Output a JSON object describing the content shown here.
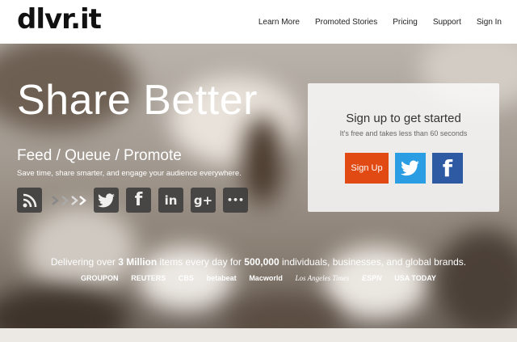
{
  "header": {
    "logo": "dlvr.it",
    "nav": [
      {
        "label": "Learn More"
      },
      {
        "label": "Promoted Stories"
      },
      {
        "label": "Pricing"
      },
      {
        "label": "Support"
      },
      {
        "label": "Sign In"
      }
    ]
  },
  "hero": {
    "headline": "Share Better",
    "sub_headline": "Feed / Queue / Promote",
    "tagline": "Save time, share smarter, and engage your audience everywhere.",
    "icons": [
      "rss-icon",
      "arrows-icon",
      "twitter-icon",
      "facebook-icon",
      "linkedin-icon",
      "google-plus-icon",
      "more-icon"
    ],
    "icon_glyphs": {
      "facebook": "f",
      "linkedin": "in",
      "google_plus": "g+",
      "more": "•••"
    }
  },
  "signup_panel": {
    "title": "Sign up to get started",
    "note": "It's free and takes less than 60 seconds",
    "signup_label": "Sign Up"
  },
  "stats": {
    "prefix": "Delivering over ",
    "items": "3 Million",
    "middle": " items every day for ",
    "individuals": "500,000",
    "suffix": " individuals, businesses, and global brands."
  },
  "brands": [
    "GROUPON",
    "REUTERS",
    "CBS",
    "betabeat",
    "Macworld",
    "Los Angeles Times",
    "ESPN",
    "USA TODAY"
  ],
  "colors": {
    "signup": "#e14b13",
    "twitter": "#2b9ee3",
    "facebook": "#2e5aa4"
  }
}
